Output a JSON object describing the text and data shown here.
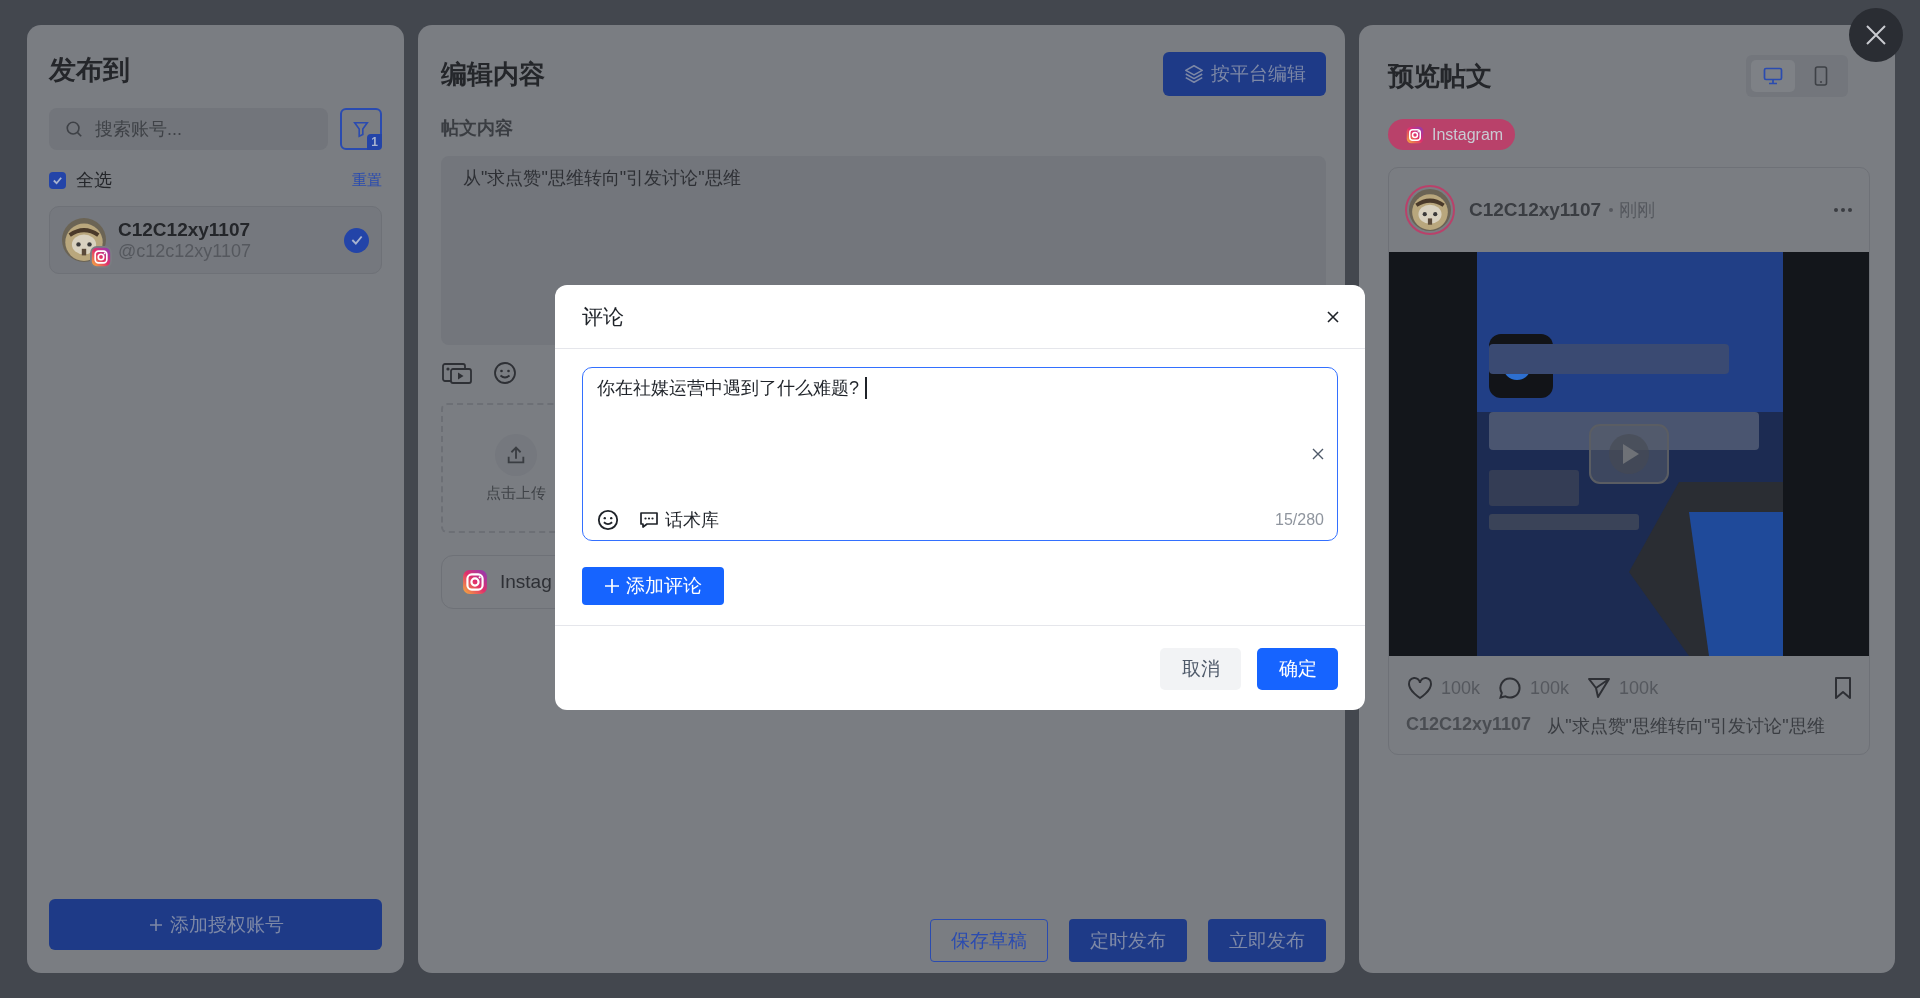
{
  "publish_panel": {
    "title": "发布到",
    "search": {
      "placeholder": "搜索账号..."
    },
    "filter_count": "1",
    "select_all": {
      "label": "全选",
      "checked": true
    },
    "reset": "重置",
    "accounts": [
      {
        "name": "C12C12xy1107",
        "handle": "@c12c12xy1107",
        "selected": true
      }
    ],
    "add_button": "添加授权账号"
  },
  "editor": {
    "title": "编辑内容",
    "platform_edit_button": "按平台编辑",
    "content_label": "帖文内容",
    "content": "从\"求点赞\"思维转向\"引发讨论\"思维",
    "upload_label": "点击上传",
    "platform_tab": "Instag",
    "actions": [
      {
        "label": "保存草稿",
        "kind": "outline"
      },
      {
        "label": "定时发布",
        "kind": "solid"
      },
      {
        "label": "立即发布",
        "kind": "solid"
      }
    ]
  },
  "preview": {
    "title": "预览帖文",
    "devices": [
      {
        "kind": "desktop",
        "selected": true
      },
      {
        "kind": "mobile",
        "selected": false
      }
    ],
    "platform": "Instagram",
    "post": {
      "name": "C12C12xy1107",
      "time": "刚刚",
      "likes": "100k",
      "comments": "100k",
      "shares": "100k",
      "caption_name": "C12C12xy1107",
      "caption": "从\"求点赞\"思维转向\"引发讨论\"思维"
    }
  },
  "comment_dialog": {
    "title": "评论",
    "comment": "你在社媒运营中遇到了什么难题?",
    "library": "话术库",
    "counter": "15/280",
    "add_button": "添加评论",
    "cancel": "取消",
    "confirm": "确定"
  }
}
